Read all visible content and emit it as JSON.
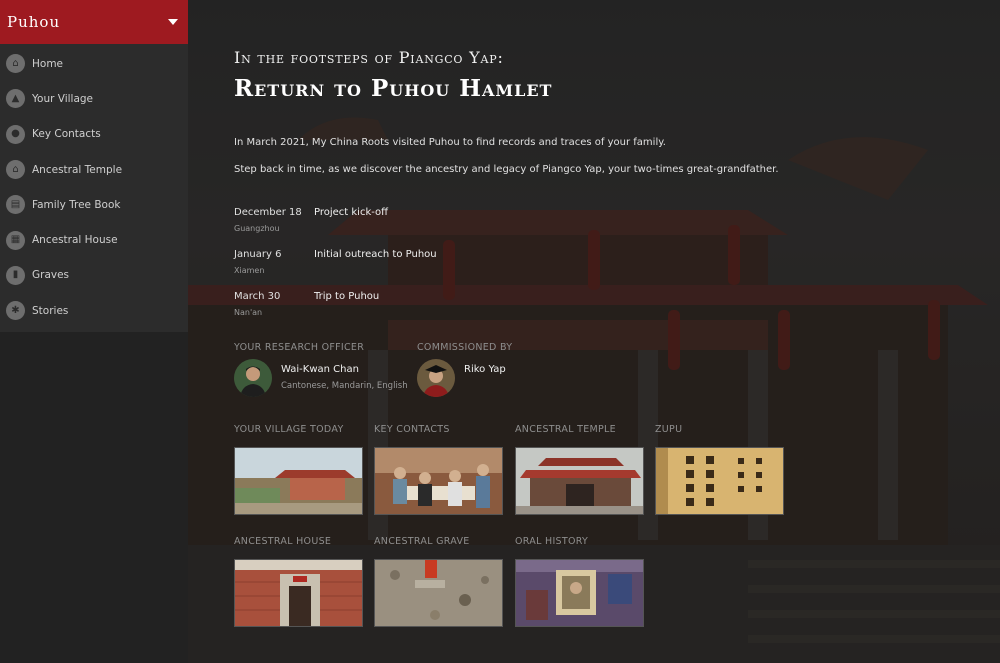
{
  "sidebar": {
    "brand": "Puhou",
    "items": [
      {
        "label": "Home",
        "icon": "home-icon"
      },
      {
        "label": "Your Village",
        "icon": "village-icon"
      },
      {
        "label": "Key Contacts",
        "icon": "contacts-icon"
      },
      {
        "label": "Ancestral Temple",
        "icon": "temple-icon"
      },
      {
        "label": "Family Tree Book",
        "icon": "book-icon"
      },
      {
        "label": "Ancestral House",
        "icon": "house-icon"
      },
      {
        "label": "Graves",
        "icon": "grave-icon"
      },
      {
        "label": "Stories",
        "icon": "stories-icon"
      }
    ]
  },
  "header": {
    "eyebrow": "In the footsteps of Piangco Yap:",
    "title": "Return to Puhou Hamlet"
  },
  "intro": {
    "line1": "In March 2021, My China Roots visited Puhou to find records and traces of your family.",
    "line2": "Step back in time, as we discover the ancestry and legacy of Piangco Yap, your two-times great-grandfather."
  },
  "timeline": [
    {
      "date": "December 18",
      "place": "Guangzhou",
      "event": "Project kick-off"
    },
    {
      "date": "January 6",
      "place": "Xiamen",
      "event": "Initial outreach to Puhou"
    },
    {
      "date": "March 30",
      "place": "Nan'an",
      "event": "Trip to Puhou"
    }
  ],
  "people": {
    "officer": {
      "label": "Your research officer",
      "name": "Wai-Kwan Chan",
      "languages": "Cantonese, Mandarin, English"
    },
    "commissioner": {
      "label": "Commissioned by",
      "name": "Riko Yap"
    }
  },
  "tiles": [
    {
      "label": "Your village today"
    },
    {
      "label": "Key contacts"
    },
    {
      "label": "Ancestral temple"
    },
    {
      "label": "Zupu"
    },
    {
      "label": "Ancestral house"
    },
    {
      "label": "Ancestral grave"
    },
    {
      "label": "Oral history"
    }
  ],
  "colors": {
    "brand_red": "#9e1a20",
    "sidebar_bg": "#2c2c2c",
    "text_muted": "#8e8e8e"
  }
}
